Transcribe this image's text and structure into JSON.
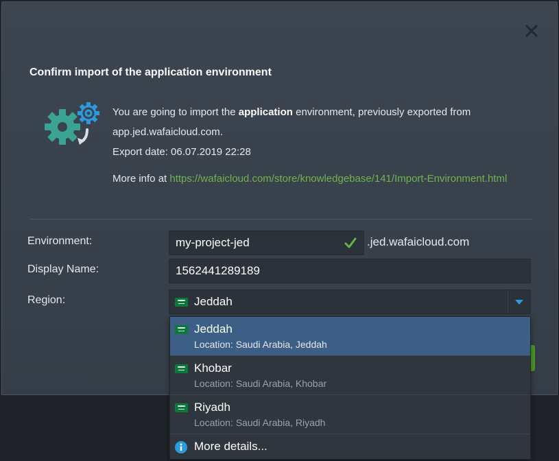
{
  "dialog": {
    "title": "Confirm import of the application environment",
    "info_prefix": "You are going to import the ",
    "info_bold": "application",
    "info_suffix": " environment, previously exported from",
    "source_host": "app.jed.wafaicloud.com.",
    "export_date": "Export date: 06.07.2019 22:28",
    "more_info_label": "More info at ",
    "more_info_link": "https://wafaicloud.com/store/knowledgebase/141/Import-Environment.html"
  },
  "form": {
    "environment_label": "Environment:",
    "environment_value": "my-project-jed",
    "environment_suffix": ".jed.wafaicloud.com",
    "display_name_label": "Display Name:",
    "display_name_value": "1562441289189",
    "region_label": "Region:",
    "region_selected": "Jeddah"
  },
  "dropdown": {
    "items": [
      {
        "name": "Jeddah",
        "location": "Location: Saudi Arabia, Jeddah"
      },
      {
        "name": "Khobar",
        "location": "Location: Saudi Arabia, Khobar"
      },
      {
        "name": "Riyadh",
        "location": "Location: Saudi Arabia, Riyadh"
      }
    ],
    "more_details": "More details..."
  },
  "icons": {
    "close": "close-icon",
    "hero": "gears-import-icon",
    "check": "check-icon",
    "flag": "saudi-flag-icon",
    "dropdown_arrow": "caret-down-icon",
    "info": "info-icon"
  },
  "colors": {
    "dialog_bg": "#3a434d",
    "link": "#6fb44f",
    "selected_row": "#3e5f85",
    "accent_blue": "#2a9bdc",
    "check_green": "#6ab04c"
  }
}
